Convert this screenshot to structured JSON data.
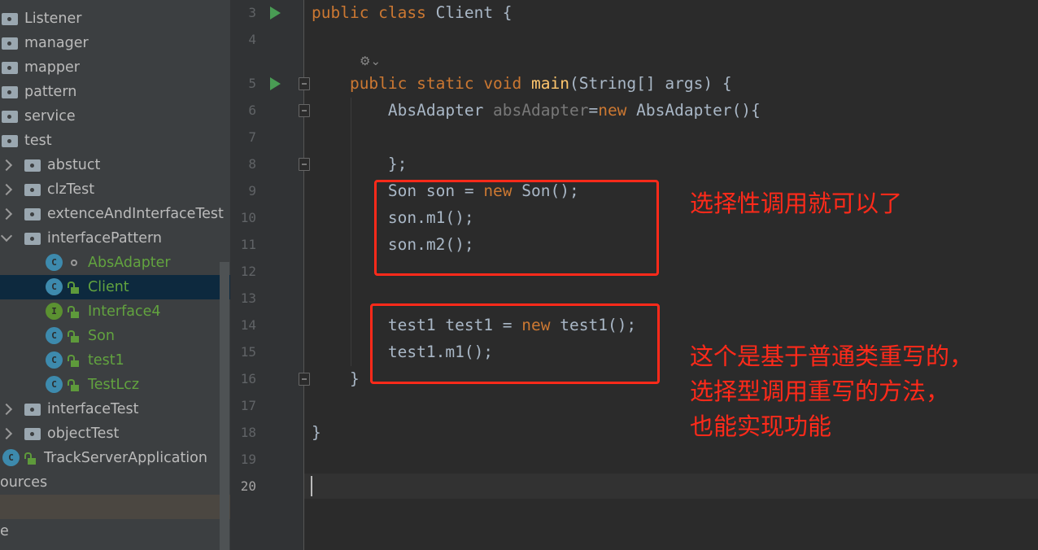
{
  "sidebar": {
    "items": [
      {
        "label": "Listener",
        "type": "folder"
      },
      {
        "label": "manager",
        "type": "folder"
      },
      {
        "label": "mapper",
        "type": "folder"
      },
      {
        "label": "pattern",
        "type": "folder"
      },
      {
        "label": "service",
        "type": "folder"
      },
      {
        "label": "test",
        "type": "folder"
      },
      {
        "label": "abstuct",
        "type": "folder"
      },
      {
        "label": "clzTest",
        "type": "folder"
      },
      {
        "label": "extenceAndInterfaceTest",
        "type": "folder"
      },
      {
        "label": "interfacePattern",
        "type": "folder"
      },
      {
        "label": "AbsAdapter",
        "type": "abstract-class"
      },
      {
        "label": "Client",
        "type": "class"
      },
      {
        "label": "Interface4",
        "type": "interface"
      },
      {
        "label": "Son",
        "type": "class"
      },
      {
        "label": "test1",
        "type": "class"
      },
      {
        "label": "TestLcz",
        "type": "class"
      },
      {
        "label": "interfaceTest",
        "type": "folder"
      },
      {
        "label": "objectTest",
        "type": "folder"
      },
      {
        "label": "TrackServerApplication",
        "type": "spring-app"
      },
      {
        "label": "ources",
        "type": "text"
      },
      {
        "label": "",
        "type": "text"
      },
      {
        "label": "e",
        "type": "text"
      }
    ],
    "selected": "Client"
  },
  "editor": {
    "line_numbers": [
      "3",
      "4",
      "5",
      "6",
      "7",
      "8",
      "9",
      "10",
      "11",
      "12",
      "13",
      "14",
      "15",
      "16",
      "17",
      "18",
      "19",
      "20"
    ],
    "current_line": "20",
    "inlay_hint_icon": "ai-assistant-icon",
    "lines": {
      "l3": [
        [
          "kw",
          "public class "
        ],
        [
          "",
          "Client {"
        ]
      ],
      "l5": [
        [
          "kw",
          "public static void "
        ],
        [
          "fn",
          "main"
        ],
        [
          "",
          "(String[] args) {"
        ]
      ],
      "l6": [
        [
          "",
          "AbsAdapter "
        ],
        [
          "dim",
          "absAdapter"
        ],
        [
          "",
          "="
        ],
        [
          "kw",
          "new "
        ],
        [
          "",
          "AbsAdapter(){"
        ]
      ],
      "l8": [
        [
          "",
          "};"
        ]
      ],
      "l9": [
        [
          "",
          "Son son = "
        ],
        [
          "kw",
          "new "
        ],
        [
          "",
          "Son();"
        ]
      ],
      "l10": [
        [
          "",
          "son.m1();"
        ]
      ],
      "l11": [
        [
          "",
          "son.m2();"
        ]
      ],
      "l14": [
        [
          "",
          "test1 test1 = "
        ],
        [
          "kw",
          "new "
        ],
        [
          "",
          "test1();"
        ]
      ],
      "l15": [
        [
          "",
          "test1.m1();"
        ]
      ],
      "l16": [
        [
          "",
          "}"
        ]
      ],
      "l18": [
        [
          "",
          "}"
        ]
      ]
    }
  },
  "annotations": {
    "note1": "选择性调用就可以了",
    "note2": [
      "这个是基于普通类重写的，",
      "选择型调用重写的方法，",
      "也能实现功能"
    ],
    "color": "#ff2a1a"
  }
}
